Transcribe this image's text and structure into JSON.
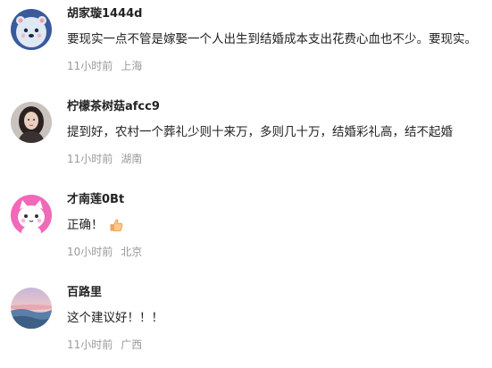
{
  "comments": [
    {
      "username": "胡家璇1444d",
      "text": "要现实一点不管是嫁娶一个人出生到结婚成本支出花费心血也不少。要现实。",
      "time": "11小时前",
      "location": "上海",
      "avatar_icon": "cartoon-bear-avatar"
    },
    {
      "username": "柠檬茶树菇afcc9",
      "text": "提到好，农村一个葬礼少则十来万，多则几十万，结婚彩礼高，结不起婚",
      "time": "11小时前",
      "location": "湖南",
      "avatar_icon": "portrait-photo-avatar"
    },
    {
      "username": "才南莲0Bt",
      "text": "正确！",
      "time": "10小时前",
      "location": "北京",
      "avatar_icon": "pink-cat-avatar",
      "emoji_icon": "thumbs-up-icon"
    },
    {
      "username": "百路里",
      "text": "这个建议好！！！",
      "time": "11小时前",
      "location": "广西",
      "avatar_icon": "sunset-landscape-avatar"
    }
  ]
}
